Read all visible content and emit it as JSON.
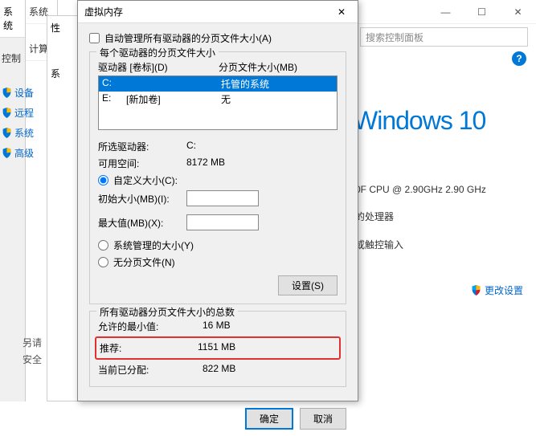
{
  "bg": {
    "search_placeholder": "搜索控制面板",
    "logo": "Windows 10",
    "cpu": "0F CPU @ 2.90GHz   2.90 GHz",
    "line2": "的处理器",
    "line3": "或触控输入",
    "change": "更改设置"
  },
  "slivers": {
    "s1": "系统",
    "s2": "系统",
    "s2b": "计算",
    "s3": "性",
    "s3b": "系",
    "cp": "控制",
    "items": [
      "设备",
      "远程",
      "系统",
      "高级"
    ],
    "also": "另请",
    "sec": "安全"
  },
  "dialog": {
    "title": "虚拟内存",
    "auto_manage": "自动管理所有驱动器的分页文件大小(A)",
    "group1_title": "每个驱动器的分页文件大小",
    "header_drive": "驱动器 [卷标](D)",
    "header_size": "分页文件大小(MB)",
    "drives": [
      {
        "letter": "C:",
        "label": "",
        "size": "托管的系统",
        "selected": true
      },
      {
        "letter": "E:",
        "label": "[新加卷]",
        "size": "无",
        "selected": false
      }
    ],
    "selected_drive_label": "所选驱动器:",
    "selected_drive_val": "C:",
    "free_space_label": "可用空间:",
    "free_space_val": "8172 MB",
    "custom_size": "自定义大小(C):",
    "initial_label": "初始大小(MB)(I):",
    "max_label": "最大值(MB)(X):",
    "system_managed": "系统管理的大小(Y)",
    "no_paging": "无分页文件(N)",
    "set_btn": "设置(S)",
    "group2_title": "所有驱动器分页文件大小的总数",
    "min_label": "允许的最小值:",
    "min_val": "16 MB",
    "recommended_label": "推荐:",
    "recommended_val": "1151 MB",
    "current_label": "当前已分配:",
    "current_val": "822 MB",
    "ok": "确定",
    "cancel": "取消"
  }
}
